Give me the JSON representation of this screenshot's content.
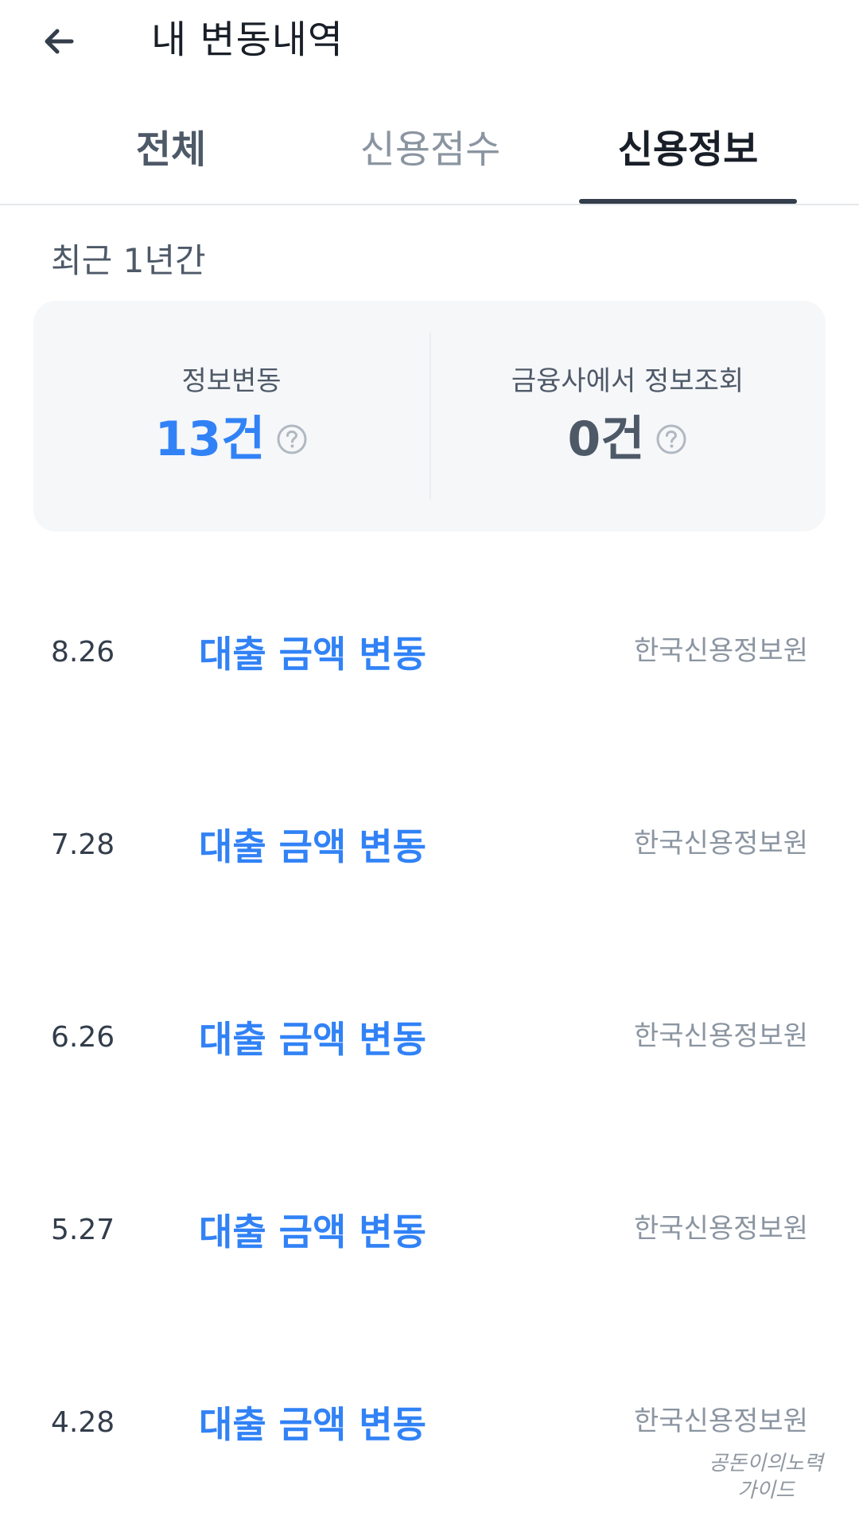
{
  "header": {
    "title": "내 변동내역",
    "back_icon": "arrow-left-icon"
  },
  "tabs": [
    {
      "label": "전체",
      "active": false
    },
    {
      "label": "신용점수",
      "active": false
    },
    {
      "label": "신용정보",
      "active": true
    }
  ],
  "period": "최근 1년간",
  "summary": {
    "info_change": {
      "label": "정보변동",
      "value": "13건"
    },
    "inquiry": {
      "label": "금융사에서 정보조회",
      "value": "0건"
    },
    "help_icon": "question-circle-icon"
  },
  "items": [
    {
      "date": "8.26",
      "title": "대출 금액 변동",
      "source": "한국신용정보원"
    },
    {
      "date": "7.28",
      "title": "대출 금액 변동",
      "source": "한국신용정보원"
    },
    {
      "date": "6.26",
      "title": "대출 금액 변동",
      "source": "한국신용정보원"
    },
    {
      "date": "5.27",
      "title": "대출 금액 변동",
      "source": "한국신용정보원"
    },
    {
      "date": "4.28",
      "title": "대출 금액 변동",
      "source": "한국신용정보원"
    }
  ],
  "watermark": {
    "line1": "공돈이의노력",
    "line2": "가이드"
  },
  "colors": {
    "accent": "#3182f6",
    "text_primary": "#191f28",
    "text_secondary": "#4e5968",
    "text_tertiary": "#8b95a1",
    "card_bg": "#f6f7f9"
  }
}
